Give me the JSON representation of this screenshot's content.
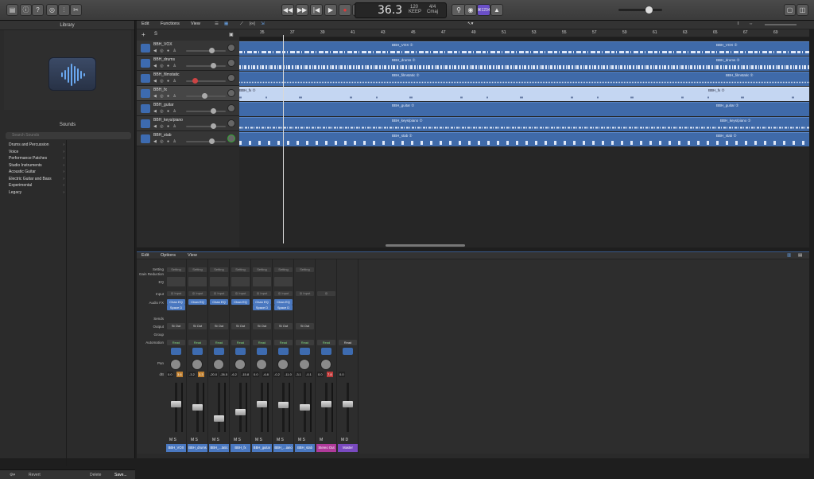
{
  "transport": {
    "position": "36.3",
    "tempo": "120",
    "tempo_label": "KEEP",
    "time_sig": "4/4",
    "key": "Cmaj",
    "cpu_badge": "⌘1234"
  },
  "library": {
    "title": "Library",
    "sounds_title": "Sounds",
    "search_placeholder": "Search Sounds",
    "categories": [
      "Drums and Percussion",
      "Voice",
      "Performance Patches",
      "Studio Instruments",
      "Acoustic Guitar",
      "Electric Guitar and Bass",
      "Experimental",
      "Legacy"
    ],
    "footer": {
      "revert": "Revert",
      "delete": "Delete",
      "save": "Save..."
    }
  },
  "tracks_menu": {
    "edit": "Edit",
    "functions": "Functions",
    "view": "View"
  },
  "ruler_ticks": [
    "35",
    "37",
    "39",
    "41",
    "43",
    "45",
    "47",
    "49",
    "51",
    "53",
    "55",
    "57",
    "59",
    "61",
    "63",
    "65",
    "67",
    "69"
  ],
  "tracks": [
    {
      "name": "BBH_VOX",
      "selected": false
    },
    {
      "name": "BBH_drums",
      "selected": false
    },
    {
      "name": "BBH_filmstatic",
      "selected": false
    },
    {
      "name": "BBH_fx",
      "selected": true
    },
    {
      "name": "BBH_guitar",
      "selected": false
    },
    {
      "name": "BBH_keys/piano",
      "selected": false
    },
    {
      "name": "BBH_stab",
      "selected": false
    }
  ],
  "regions": [
    {
      "label": "BBH_VOX ②",
      "label2": "BBH_VOX ②"
    },
    {
      "label": "BBH_drums ②",
      "label2": "BBH_drums ②"
    },
    {
      "label": "BBH_filmstatic ②",
      "label2": "BBH_filmstatic ②"
    },
    {
      "label": "BBH_fx ②",
      "label2": "BBH_fx ②"
    },
    {
      "label": "BBH_guitar ②",
      "label2": "BBH_guitar ②"
    },
    {
      "label": "BBH_keys/piano ②",
      "label2": "BBH_keys/piano ②"
    },
    {
      "label": "BBH_stab ②",
      "label2": "BBH_stab ②"
    }
  ],
  "mixer_menu": {
    "edit": "Edit",
    "options": "Options",
    "view": "View"
  },
  "mixer_labels": {
    "setting": "Setting",
    "gain": "Gain Reduction",
    "eq": "EQ",
    "input": "Input",
    "audiofx": "Audio FX",
    "sends": "Sends",
    "output": "Output",
    "group": "Group",
    "automation": "Automation",
    "pan": "Pan",
    "db": "dB"
  },
  "strips": [
    {
      "name": "BBH_VOX",
      "fx1": "Chan EQ",
      "fx2": "Space D",
      "output": "St Out",
      "read": "Read",
      "db": "0.0",
      "peak": "3.6",
      "ms": "M S"
    },
    {
      "name": "BBH_drums",
      "fx1": "Chan EQ",
      "fx2": "",
      "output": "St Out",
      "read": "Read",
      "db": "-3.2",
      "peak": "3.3",
      "ms": "M S"
    },
    {
      "name": "BBH_...tatic",
      "fx1": "Chan EQ",
      "fx2": "",
      "output": "St Out",
      "read": "Read",
      "db": "-20.0",
      "peak": "-26.5",
      "ms": "M S"
    },
    {
      "name": "BBH_fx",
      "fx1": "Chan EQ",
      "fx2": "",
      "output": "St Out",
      "read": "Read",
      "db": "-6.2",
      "peak": "-15.8",
      "ms": "M S"
    },
    {
      "name": "BBH_guitar",
      "fx1": "Chan EQ",
      "fx2": "Space D",
      "output": "St Out",
      "read": "Read",
      "db": "0.0",
      "peak": "-6.8",
      "ms": "M S"
    },
    {
      "name": "BBH_...iano",
      "fx1": "Chan EQ",
      "fx2": "Space D",
      "output": "St Out",
      "read": "Read",
      "db": "-0.2",
      "peak": "-11.0",
      "ms": "M S"
    },
    {
      "name": "BBH_stab",
      "fx1": "",
      "fx2": "",
      "output": "St Out",
      "read": "Read",
      "db": "-3.1",
      "peak": "-0.1",
      "ms": "M S"
    },
    {
      "name": "Stereo Out",
      "fx1": "",
      "fx2": "",
      "output": "",
      "read": "Read",
      "db": "0.0",
      "peak": "7.8",
      "ms": "M"
    },
    {
      "name": "Master",
      "fx1": "",
      "fx2": "",
      "output": "",
      "read": "Read",
      "db": "0.0",
      "peak": "",
      "ms": "M D"
    }
  ]
}
